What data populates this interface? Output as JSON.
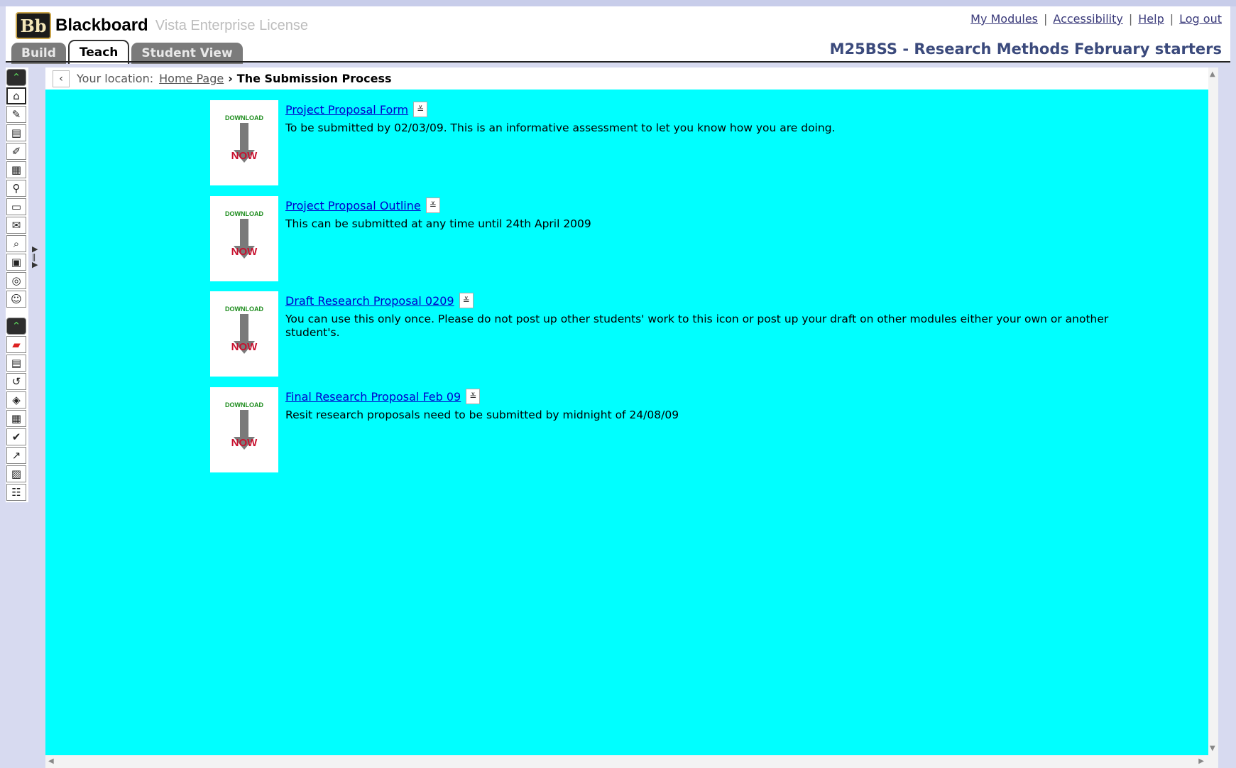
{
  "header": {
    "logo_mark": "Bb",
    "brand": "Blackboard",
    "license": "Vista Enterprise License",
    "links": [
      "My Modules",
      "Accessibility",
      "Help",
      "Log out"
    ],
    "course_title": "M25BSS - Research Methods February starters"
  },
  "tabs": [
    "Build",
    "Teach",
    "Student View"
  ],
  "active_tab": "Teach",
  "toolbar": {
    "icons": [
      "collapse-up-icon",
      "home-icon",
      "tools-icon",
      "assignment-icon",
      "marker-icon",
      "calendar-icon",
      "pin-icon",
      "document-icon",
      "mail-icon",
      "search-icon",
      "folder-icon",
      "globe-icon",
      "roster-icon",
      "collapse-up-icon",
      "books-icon",
      "quiz-icon",
      "tracking-icon",
      "stamp-icon",
      "grid-icon",
      "assessment-icon",
      "chart-icon",
      "report-icon",
      "settings-icon"
    ]
  },
  "location": {
    "label": "Your location:",
    "home": "Home Page",
    "separator": "›",
    "current": "The Submission Process"
  },
  "thumb": {
    "top": "DOWNLOAD",
    "bottom": "NOW"
  },
  "items": [
    {
      "title": "Project Proposal Form",
      "description": "To be submitted by 02/03/09. This is an informative assessment to let you know how you are doing."
    },
    {
      "title": "Project Proposal Outline",
      "description": "This can be submitted at any time until 24th April 2009"
    },
    {
      "title": "Draft Research Proposal 0209",
      "description": "You can use this only once. Please do not post up other students' work to this icon or post up your draft on other modules either your own or another student's."
    },
    {
      "title": "Final Research Proposal Feb 09",
      "description": "Resit research proposals need to be submitted by midnight of 24/08/09"
    }
  ],
  "colors": {
    "content_bg": "#00ffff",
    "link": "#0000cc",
    "title": "#3b4a7c"
  }
}
